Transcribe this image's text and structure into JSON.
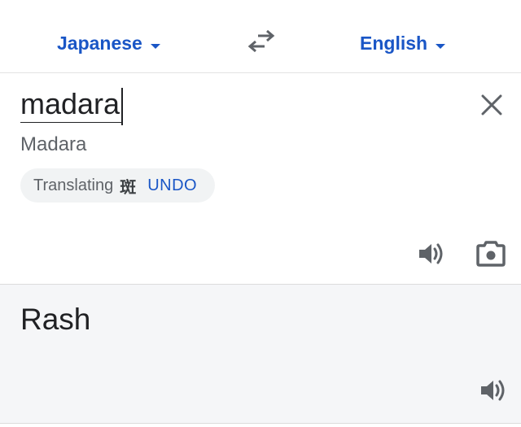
{
  "lang_bar": {
    "source_language": "Japanese",
    "target_language": "English",
    "swap_icon": "swap-arrows-icon"
  },
  "source": {
    "input_value": "madara",
    "transliteration": "Madara",
    "suggestion_chip": {
      "label": "Translating",
      "kanji": "斑",
      "undo_label": "UNDO"
    },
    "clear_icon": "close-icon",
    "speaker_icon": "speaker-icon",
    "camera_icon": "camera-icon"
  },
  "result": {
    "text": "Rash",
    "speaker_icon": "speaker-icon"
  },
  "colors": {
    "accent": "#1a56c6",
    "icon": "#5f6368",
    "result_bg": "#f5f6f8"
  }
}
